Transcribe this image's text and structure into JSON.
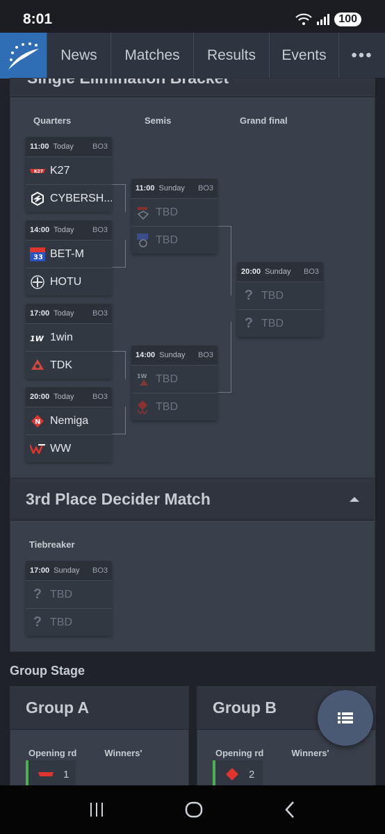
{
  "status": {
    "time": "8:01",
    "battery": "100"
  },
  "nav": {
    "items": [
      "News",
      "Matches",
      "Results",
      "Events"
    ],
    "more": "•••"
  },
  "bracket": {
    "title": "Single Elimination Bracket",
    "rounds": [
      "Quarters",
      "Semis",
      "Grand final"
    ],
    "matches": [
      {
        "time": "11:00",
        "day": "Today",
        "format": "BO3",
        "teams": [
          "K27",
          "CYBERSH..."
        ]
      },
      {
        "time": "14:00",
        "day": "Today",
        "format": "BO3",
        "teams": [
          "BET-M",
          "HOTU"
        ]
      },
      {
        "time": "17:00",
        "day": "Today",
        "format": "BO3",
        "teams": [
          "1win",
          "TDK"
        ]
      },
      {
        "time": "20:00",
        "day": "Today",
        "format": "BO3",
        "teams": [
          "Nemiga",
          "WW"
        ]
      },
      {
        "time": "11:00",
        "day": "Sunday",
        "format": "BO3",
        "teams": [
          "TBD",
          "TBD"
        ]
      },
      {
        "time": "14:00",
        "day": "Sunday",
        "format": "BO3",
        "teams": [
          "TBD",
          "TBD"
        ]
      },
      {
        "time": "20:00",
        "day": "Sunday",
        "format": "BO3",
        "teams": [
          "TBD",
          "TBD"
        ]
      }
    ]
  },
  "third": {
    "title": "3rd Place Decider Match",
    "round": "Tiebreaker",
    "match": {
      "time": "17:00",
      "day": "Sunday",
      "format": "BO3",
      "teams": [
        "TBD",
        "TBD"
      ]
    }
  },
  "groups": {
    "title": "Group Stage",
    "items": [
      {
        "name": "Group A",
        "col1": "Opening rd",
        "col2": "Winners'",
        "seed": "1"
      },
      {
        "name": "Group B",
        "col1": "Opening rd",
        "col2": "Winners'",
        "seed": "2"
      }
    ]
  },
  "colors": {
    "accent": "#2f6db5",
    "panel": "#3a404b",
    "win": "#4caf50"
  }
}
